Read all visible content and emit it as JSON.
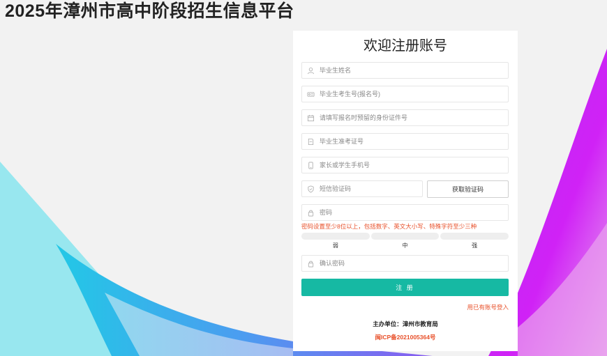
{
  "site": {
    "title": "2025年漳州市高中阶段招生信息平台"
  },
  "form": {
    "title": "欢迎注册账号",
    "fields": [
      {
        "icon": "user-icon",
        "placeholder": "毕业生姓名"
      },
      {
        "icon": "id-card-icon",
        "placeholder": "毕业生考生号(报名号)"
      },
      {
        "icon": "calendar-icon",
        "placeholder": "请填写报名时预留的身份证件号"
      },
      {
        "icon": "document-icon",
        "placeholder": "毕业生准考证号"
      },
      {
        "icon": "phone-icon",
        "placeholder": "家长或学生手机号"
      },
      {
        "icon": "shield-icon",
        "placeholder": "短信验证码"
      },
      {
        "icon": "lock-icon",
        "placeholder": "密码"
      },
      {
        "icon": "lock-icon",
        "placeholder": "确认密码"
      }
    ],
    "get_code_label": "获取验证码",
    "password_hint": "密码设置至少8位以上，包括数字、英文大小写、特殊字符至少三种",
    "strength_labels": [
      "弱",
      "中",
      "强"
    ],
    "submit_label": "注 册",
    "login_link": "用已有账号登入",
    "organizer": "主办单位：漳州市教育局",
    "icp": "闽ICP备2021005364号"
  },
  "colors": {
    "accent": "#16b9a3",
    "warning": "#e8502a",
    "purple": "#c020f0",
    "cyan": "#1ec8e4"
  }
}
